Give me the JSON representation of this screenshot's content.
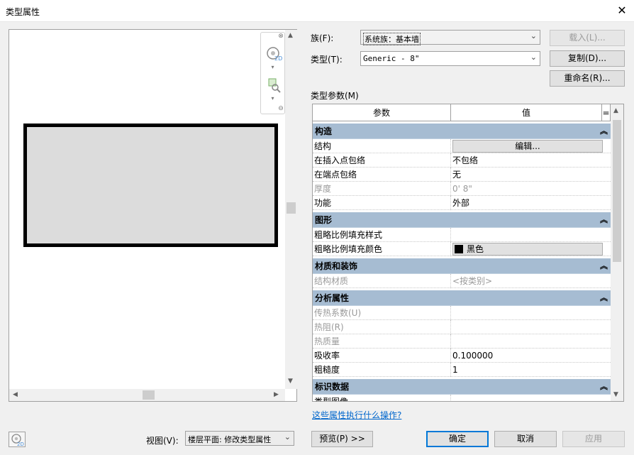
{
  "window": {
    "title": "类型属性",
    "close_glyph": "✕"
  },
  "family": {
    "label": "族(F):",
    "value": "系统族：基本墙",
    "load_button": "载入(L)..."
  },
  "type": {
    "label": "类型(T):",
    "value": "Generic - 8\"",
    "duplicate_button": "复制(D)...",
    "rename_button": "重命名(R)..."
  },
  "params": {
    "section_label": "类型参数(M)",
    "col_param": "参数",
    "col_value": "值",
    "col_extra": "=",
    "groups": {
      "construction": "构造",
      "graphics": "图形",
      "materials": "材质和装饰",
      "analytical": "分析属性",
      "identity": "标识数据"
    },
    "rows": {
      "structure": {
        "name": "结构",
        "value": "编辑..."
      },
      "wrap_insert": {
        "name": "在插入点包络",
        "value": "不包络"
      },
      "wrap_end": {
        "name": "在端点包络",
        "value": "无"
      },
      "thickness": {
        "name": "厚度",
        "value": "0'  8\""
      },
      "function": {
        "name": "功能",
        "value": "外部"
      },
      "coarse_pattern": {
        "name": "粗略比例填充样式",
        "value": ""
      },
      "coarse_color": {
        "name": "粗略比例填充颜色",
        "value": "黑色"
      },
      "struct_material": {
        "name": "结构材质",
        "value": "<按类别>"
      },
      "heat_transfer": {
        "name": "传热系数(U)",
        "value": ""
      },
      "thermal_resistance": {
        "name": "热阻(R)",
        "value": ""
      },
      "thermal_mass": {
        "name": "热质量",
        "value": ""
      },
      "absorptance": {
        "name": "吸收率",
        "value": "0.100000"
      },
      "roughness": {
        "name": "粗糙度",
        "value": "1"
      },
      "type_image": {
        "name": "类型图像",
        "value": ""
      }
    }
  },
  "help_link": "这些属性执行什么操作?",
  "footer": {
    "view_label": "视图(V):",
    "view_value": "楼层平面: 修改类型属性",
    "preview_button": "预览(P) >>",
    "ok_button": "确定",
    "cancel_button": "取消",
    "apply_button": "应用"
  },
  "colors": {
    "group_header": "#a6bcd2",
    "link": "#0066cc",
    "ok_border": "#0078d7",
    "wall_fill": "#dcdcdc"
  },
  "icons": [
    "close-icon",
    "steering-wheel-2d-icon",
    "zoom-icon",
    "view-2d-icon",
    "dropdown-arrow-icon",
    "collapse-icon"
  ]
}
